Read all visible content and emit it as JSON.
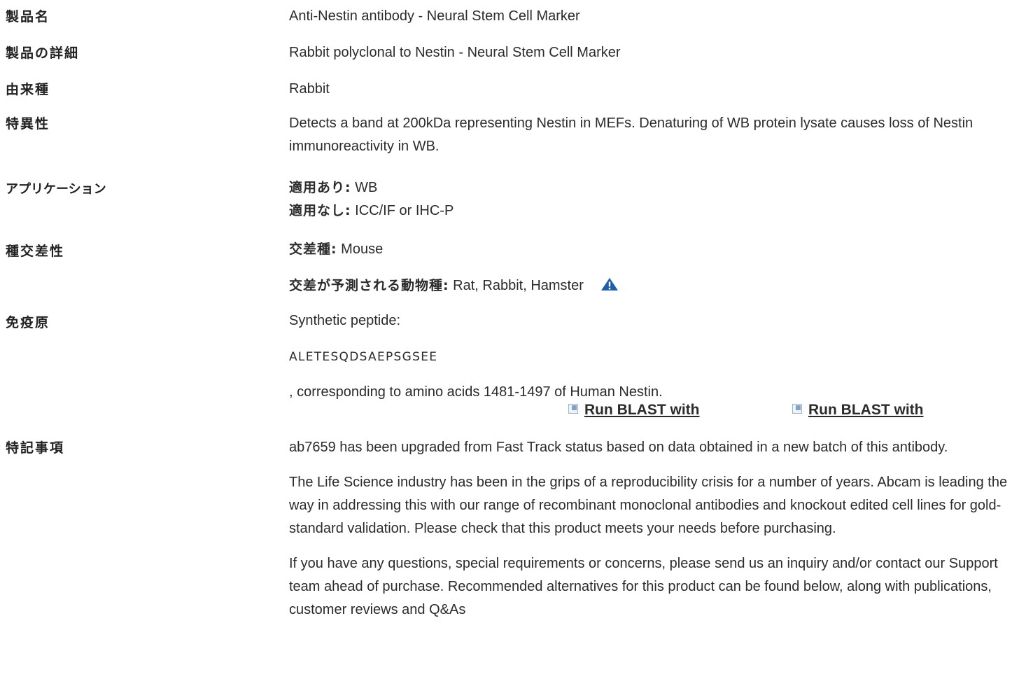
{
  "rows": {
    "product_name": {
      "label": "製品名",
      "value": "Anti-Nestin antibody - Neural Stem Cell Marker"
    },
    "product_detail": {
      "label": "製品の詳細",
      "value": "Rabbit polyclonal to Nestin - Neural Stem Cell Marker"
    },
    "host": {
      "label": "由来種",
      "value": "Rabbit"
    },
    "specificity": {
      "label": "特異性",
      "value": "Detects a band at 200kDa representing Nestin in MEFs. Denaturing of WB protein lysate causes loss of Nestin immunoreactivity in WB."
    },
    "applications": {
      "label": "アプリケーション",
      "tested_label": "適用あり:",
      "tested_value": " WB",
      "not_tested_label": "適用なし:",
      "not_tested_value": " ICC/IF or IHC-P"
    },
    "reactivity": {
      "label": "種交差性",
      "reacts_label": "交差種:",
      "reacts_value": " Mouse",
      "predicted_label": "交差が予測される動物種:",
      "predicted_value": " Rat, Rabbit, Hamster",
      "warning_icon": "warning-triangle-icon"
    },
    "immunogen": {
      "label": "免疫原",
      "line1": "Synthetic peptide:",
      "sequence": "ALETESQDSAEPSGSEE",
      "line3": ", corresponding to amino acids 1481-1497 of Human Nestin.",
      "blast_links": [
        "Run BLAST with",
        "Run BLAST with"
      ],
      "link_icon": "external-link-icon"
    },
    "notes": {
      "label": "特記事項",
      "p1": "ab7659 has been upgraded from Fast Track status based on data obtained in a new batch of this antibody.",
      "p2": "The Life Science industry has been in the grips of a reproducibility crisis for a number of years. Abcam is leading the way in addressing this with our range of recombinant monoclonal antibodies and knockout edited cell lines for gold-standard validation. Please check that this product meets your needs before purchasing.",
      "p3": "If you have any questions, special requirements or concerns, please send us an inquiry and/or contact our Support team ahead of purchase. Recommended alternatives for this product can be found below, along with publications, customer reviews and Q&As"
    }
  },
  "colors": {
    "text": "#2b2b2b",
    "warning_icon": "#1f5fa8"
  }
}
